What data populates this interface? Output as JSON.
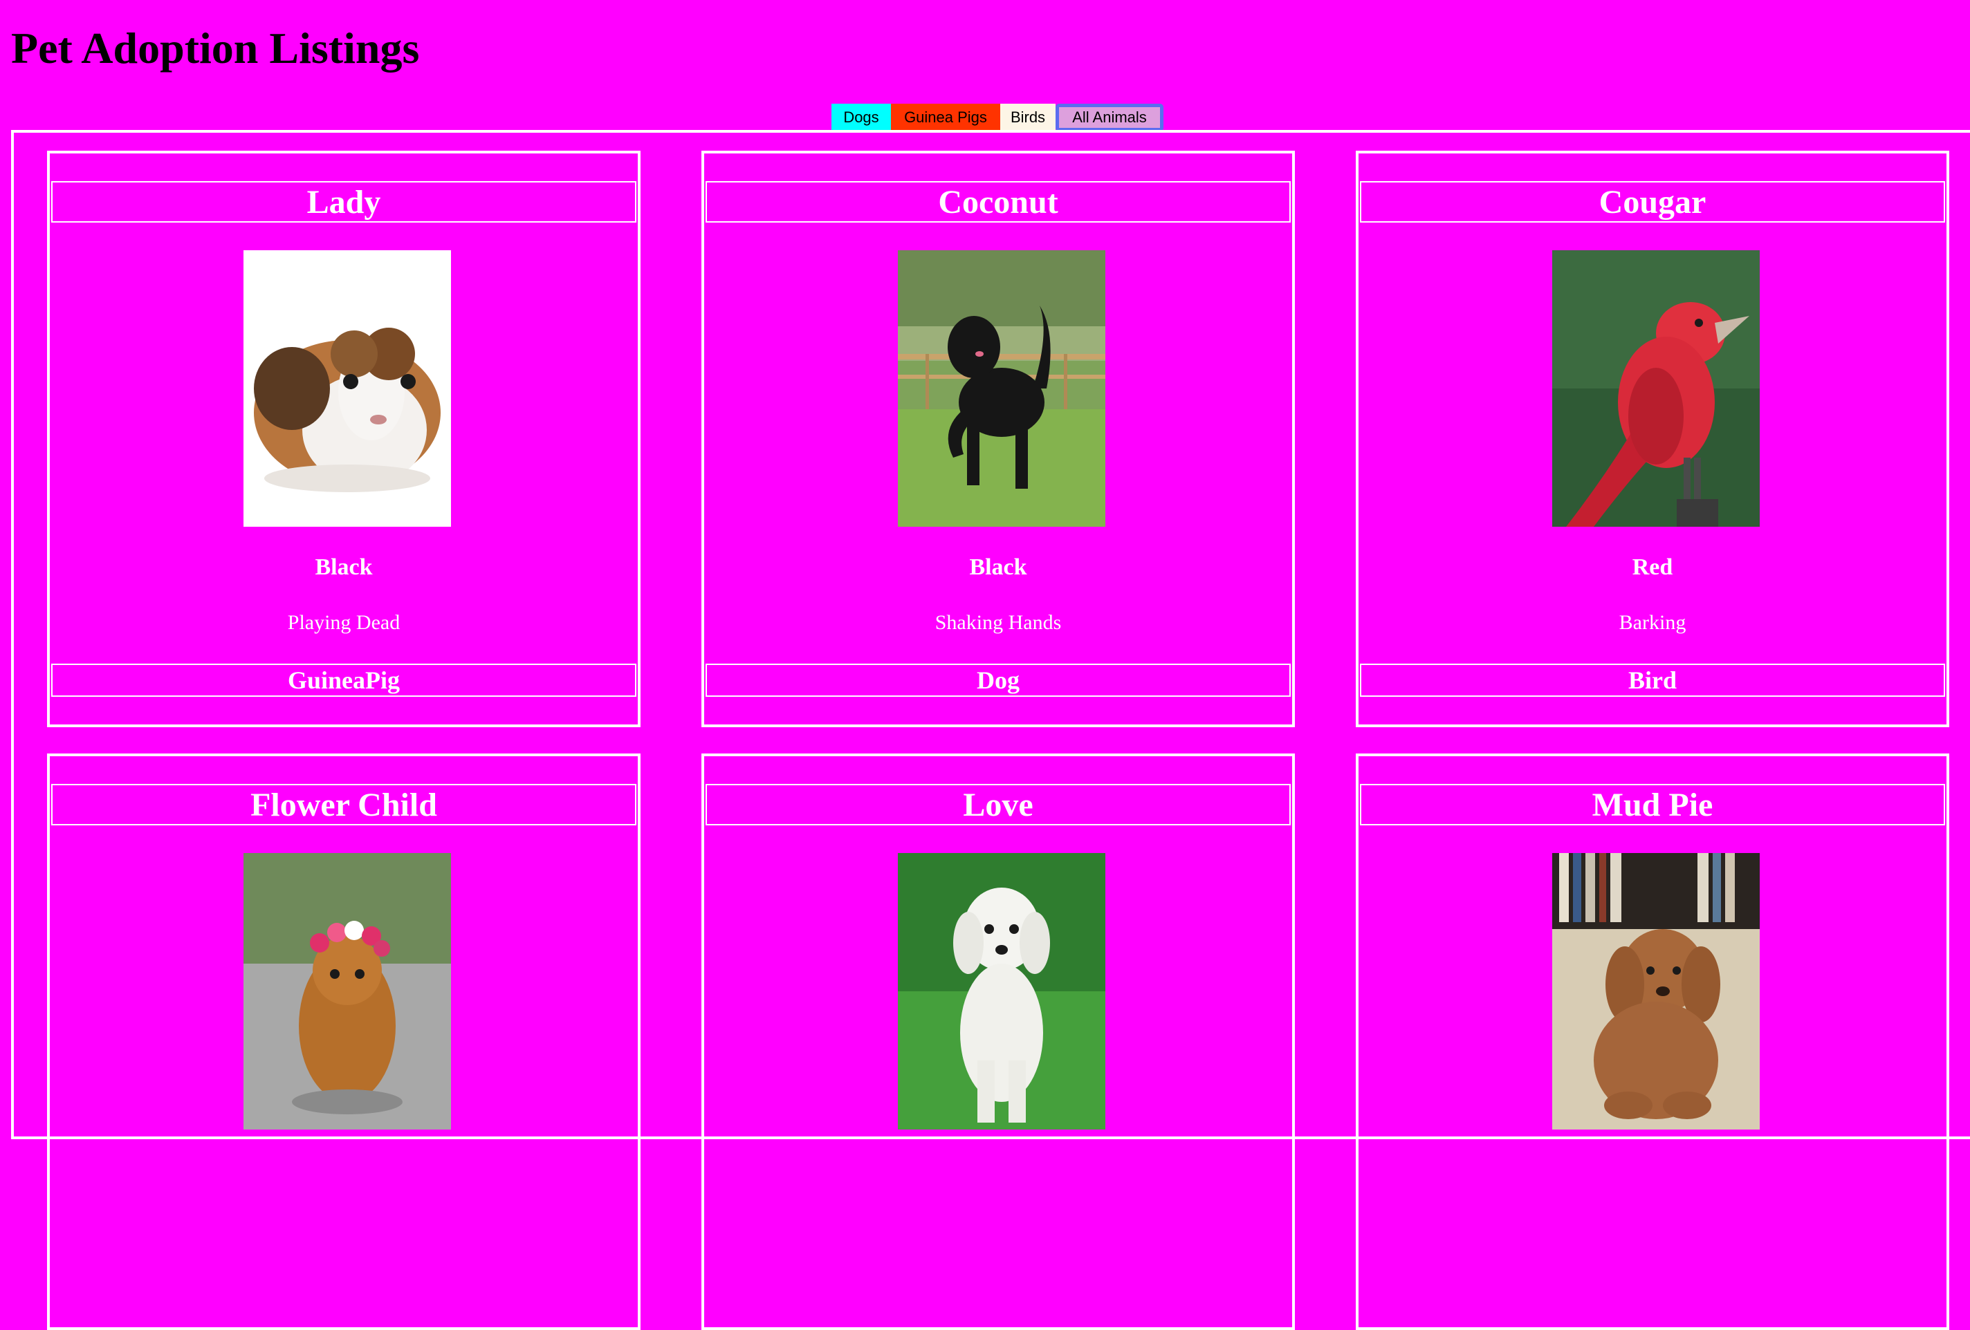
{
  "page": {
    "title": "Pet Adoption Listings"
  },
  "filters": {
    "dogs": "Dogs",
    "guinea_pigs": "Guinea Pigs",
    "birds": "Birds",
    "all": "All Animals"
  },
  "colors": {
    "background": "#ff00ff",
    "dogs_button": "#00ffff",
    "guinea_button": "#ff3300",
    "birds_button": "#fdf5e6",
    "all_button": "#dda0dd",
    "card_border": "#ffffff"
  },
  "pets": [
    {
      "name": "Lady",
      "color": "Black",
      "trick": "Playing Dead",
      "species": "GuineaPig",
      "photo": "guinea-pig-photo"
    },
    {
      "name": "Coconut",
      "color": "Black",
      "trick": "Shaking Hands",
      "species": "Dog",
      "photo": "black-dog-photo"
    },
    {
      "name": "Cougar",
      "color": "Red",
      "trick": "Barking",
      "species": "Bird",
      "photo": "red-bird-photo"
    },
    {
      "name": "Flower Child",
      "color": "",
      "trick": "",
      "species": "",
      "photo": "guinea-pig-flower-crown-photo"
    },
    {
      "name": "Love",
      "color": "",
      "trick": "",
      "species": "",
      "photo": "white-dog-photo"
    },
    {
      "name": "Mud Pie",
      "color": "",
      "trick": "",
      "species": "",
      "photo": "brown-puppy-photo"
    }
  ]
}
